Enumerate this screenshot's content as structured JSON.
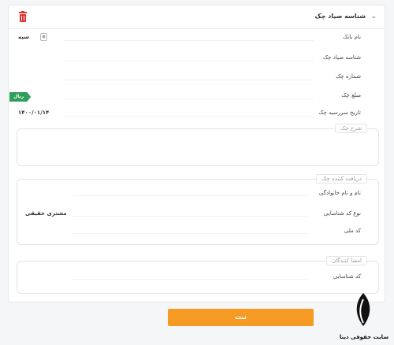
{
  "header": {
    "title": "شناسه صیاد چک",
    "chevron_icon": "chevron-down-icon",
    "delete_icon": "trash-icon",
    "delete_color": "#e03131"
  },
  "fields": {
    "bank_label": "نام بانک",
    "bank_value": "سپه",
    "sayad_label": "شناسه صیاد چک",
    "number_label": "شماره چک",
    "amount_label": "مبلغ چک",
    "amount_unit": "ریال",
    "due_label": "تاریخ سررسید چک",
    "due_value": "۱۴۰۰/۰۱/۱۴"
  },
  "description": {
    "legend": "شرح چک"
  },
  "receiver": {
    "legend": "دریافت کننده چک",
    "name_label": "نام و نام خانوادگی",
    "id_type_label": "نوع کد شناسایی",
    "id_type_value": "مشتری حقیقی",
    "national_code_label": "کد ملی"
  },
  "signers": {
    "legend": "امضا کنندگان",
    "id_label": "کد شناسایی"
  },
  "submit_label": "ثبت",
  "watermark": {
    "text": "سایت حقوقی دینا"
  },
  "colors": {
    "accent": "#f59a23",
    "tag": "#2e9e5b"
  }
}
